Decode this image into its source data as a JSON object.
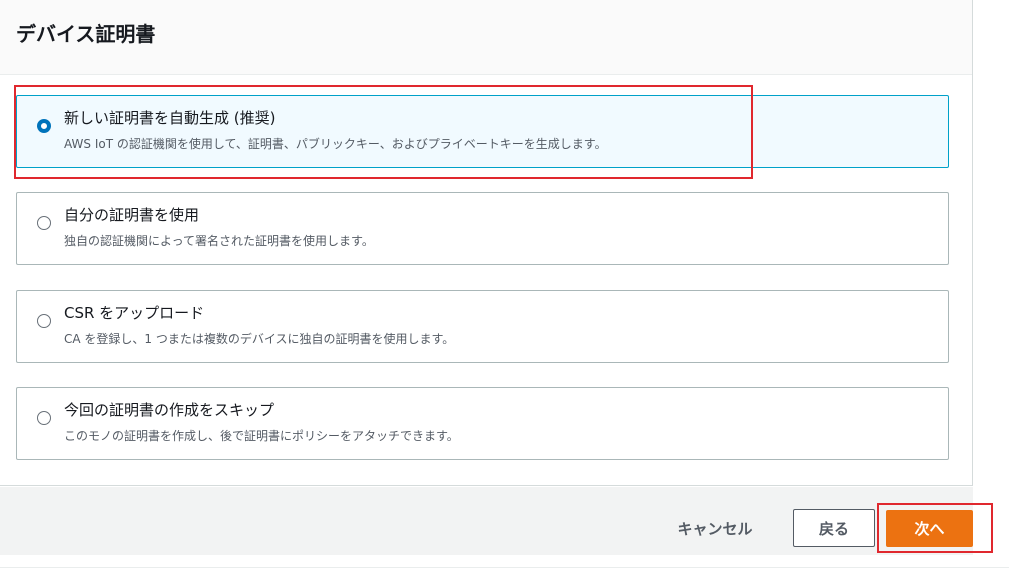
{
  "section": {
    "title": "デバイス証明書"
  },
  "options": [
    {
      "label": "新しい証明書を自動生成 (推奨)",
      "description": "AWS IoT の認証機関を使用して、証明書、パブリックキー、およびプライベートキーを生成します。",
      "selected": true
    },
    {
      "label": "自分の証明書を使用",
      "description": "独自の認証機関によって署名された証明書を使用します。",
      "selected": false
    },
    {
      "label": "CSR をアップロード",
      "description": "CA を登録し、1 つまたは複数のデバイスに独自の証明書を使用します。",
      "selected": false
    },
    {
      "label": "今回の証明書の作成をスキップ",
      "description": "このモノの証明書を作成し、後で証明書にポリシーをアタッチできます。",
      "selected": false
    }
  ],
  "footer": {
    "cancel_label": "キャンセル",
    "back_label": "戻る",
    "next_label": "次へ"
  },
  "colors": {
    "primary_button": "#ec7211",
    "selected_radio": "#0073bb",
    "selected_tile_bg": "#f1faff",
    "selected_tile_border": "#00a1c9",
    "highlight_annotation": "#e0282e"
  }
}
